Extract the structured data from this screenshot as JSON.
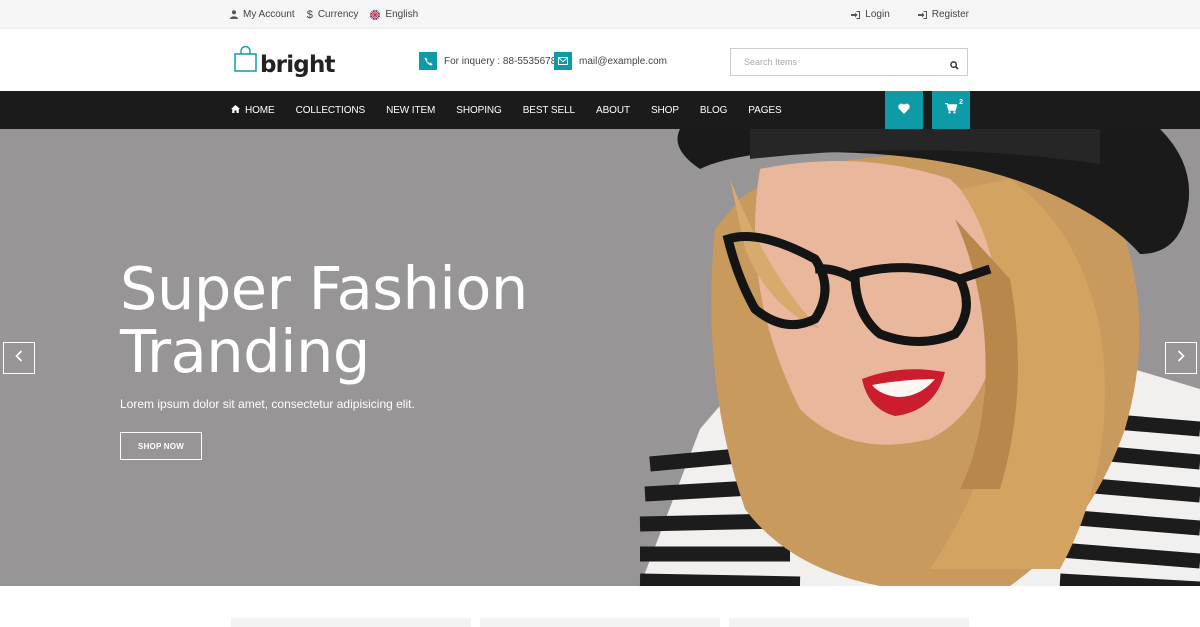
{
  "topbar": {
    "my_account": "My Account",
    "currency": "Currency",
    "language": "English",
    "login": "Login",
    "register": "Register"
  },
  "header": {
    "logo_text": "bright",
    "phone_text": "For inquery : 88-5535678",
    "email_text": "mail@example.com",
    "search_placeholder": "Search Items"
  },
  "nav": {
    "items": [
      {
        "label": "HOME",
        "icon": "home-icon"
      },
      {
        "label": "COLLECTIONS"
      },
      {
        "label": "NEW ITEM"
      },
      {
        "label": "SHOPING"
      },
      {
        "label": "BEST SELL"
      },
      {
        "label": "ABOUT"
      },
      {
        "label": "SHOP"
      },
      {
        "label": "BLOG"
      },
      {
        "label": "PAGES"
      }
    ],
    "cart_count": "2"
  },
  "hero": {
    "title_line1": "Super Fashion",
    "title_line2": "Tranding",
    "subtitle": "Lorem ipsum dolor sit amet, consectetur adipisicing elit.",
    "cta": "SHOP NOW"
  },
  "colors": {
    "accent": "#0e9aa7",
    "nav_bg": "#1b1b1b",
    "hero_bg": "#979596"
  }
}
